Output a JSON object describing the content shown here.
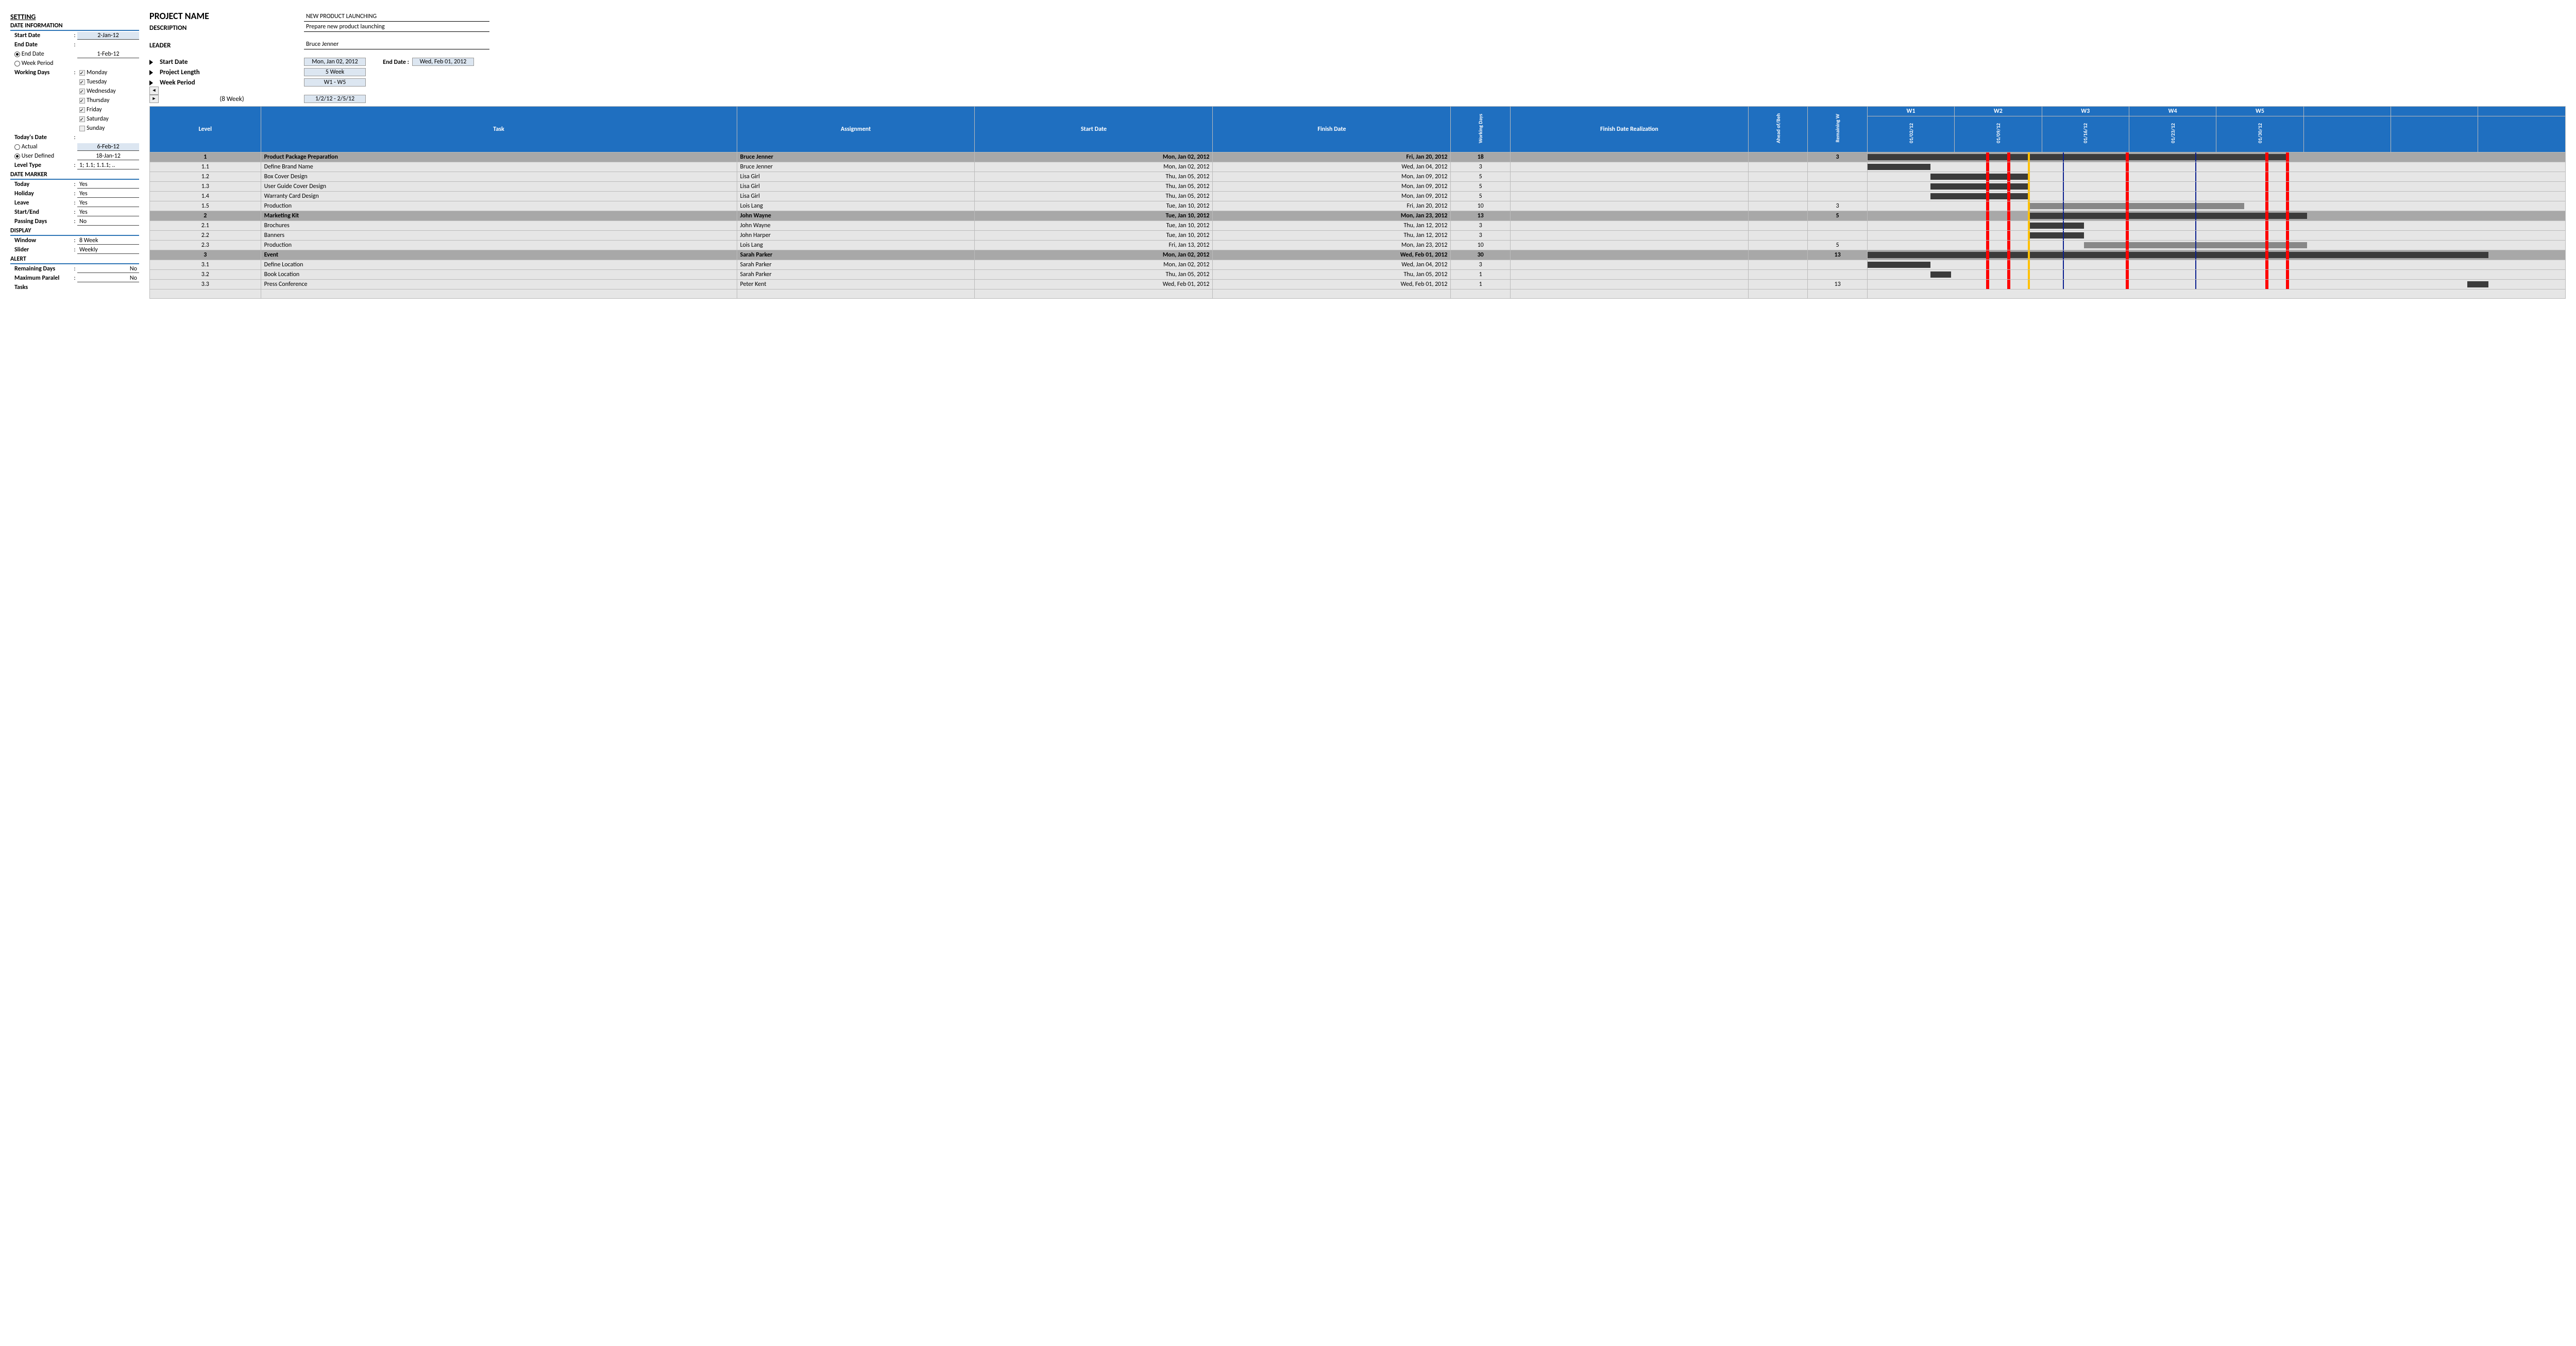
{
  "settings": {
    "title": "SETTING",
    "dateInfo": {
      "header": "DATE INFORMATION",
      "startDateLabel": "Start Date",
      "startDate": "2-Jan-12",
      "endDateLabel": "End Date",
      "endDateRadioLabel": "End Date",
      "endDate": "1-Feb-12",
      "weekPeriodRadioLabel": "Week Period",
      "workingDaysLabel": "Working Days",
      "days": [
        "Monday",
        "Tuesday",
        "Wednesday",
        "Thursday",
        "Friday",
        "Saturday",
        "Sunday"
      ]
    },
    "today": {
      "label": "Today's Date",
      "actualLabel": "Actual",
      "actualDate": "6-Feb-12",
      "userDefLabel": "User Defined",
      "userDefDate": "18-Jan-12",
      "levelTypeLabel": "Level Type",
      "levelType": "1; 1.1; 1.1.1; .."
    },
    "marker": {
      "header": "DATE MARKER",
      "items": [
        {
          "label": "Today",
          "value": "Yes"
        },
        {
          "label": "Holiday",
          "value": "Yes"
        },
        {
          "label": "Leave",
          "value": "Yes"
        },
        {
          "label": "Start/End",
          "value": "Yes"
        },
        {
          "label": "Passing Days",
          "value": "No"
        }
      ]
    },
    "display": {
      "header": "DISPLAY",
      "windowLabel": "Window",
      "window": "8 Week",
      "sliderLabel": "Slider",
      "slider": "Weekly"
    },
    "alert": {
      "header": "ALERT",
      "remLabel": "Remaining Days",
      "rem": "No",
      "maxLabel": "Maximum Paralel",
      "max": "No",
      "tasksLabel": "Tasks"
    }
  },
  "project": {
    "nameLabel": "PROJECT NAME",
    "name": "NEW PRODUCT LAUNCHING",
    "descLabel": "DESCRIPTION",
    "desc": "Prepare new product launching",
    "leaderLabel": "LEADER",
    "leader": "Bruce Jenner",
    "startDateLabel": "Start Date",
    "startDate": "Mon, Jan 02, 2012",
    "endDateLabel": "End Date :",
    "endDate": "Wed, Feb 01, 2012",
    "lengthLabel": "Project Length",
    "length": "5 Week",
    "weekPeriodLabel": "Week Period",
    "weekPeriod": "W1 - W5",
    "windowNote": "(8 Week)",
    "windowRange": "1/2/12 - 2/5/12"
  },
  "grid": {
    "headers": {
      "level": "Level",
      "task": "Task",
      "assignment": "Assignment",
      "start": "Start Date",
      "finish": "Finish Date",
      "wd": "Working Days",
      "fr": "Finish Date Realization",
      "ab": "Ahead of/Beh",
      "rw": "Remaining W"
    },
    "weeks": [
      "W1",
      "W2",
      "W3",
      "W4",
      "W5",
      "",
      "",
      ""
    ],
    "weekDates": [
      "01/02/12",
      "01/09/12",
      "01/16/12",
      "01/23/12",
      "01/30/12",
      "",
      "",
      ""
    ],
    "rows": [
      {
        "sum": true,
        "level": "1",
        "task": "Product Package Preparation",
        "asg": "Bruce Jenner",
        "sd": "Mon, Jan 02, 2012",
        "fd": "Fri, Jan 20, 2012",
        "wd": "18",
        "rw": "3",
        "barStart": 0,
        "barEnd": 60,
        "lt": false
      },
      {
        "sum": false,
        "level": "1.1",
        "task": "Define Brand Name",
        "asg": "Bruce Jenner",
        "sd": "Mon, Jan 02, 2012",
        "fd": "Wed, Jan 04, 2012",
        "wd": "3",
        "rw": "",
        "barStart": 0,
        "barEnd": 9,
        "lt": false
      },
      {
        "sum": false,
        "level": "1.2",
        "task": "Box Cover Design",
        "asg": "Lisa Girl",
        "sd": "Thu, Jan 05, 2012",
        "fd": "Mon, Jan 09, 2012",
        "wd": "5",
        "rw": "",
        "barStart": 9,
        "barEnd": 23,
        "lt": false
      },
      {
        "sum": false,
        "level": "1.3",
        "task": "User Guide Cover Design",
        "asg": "Lisa Girl",
        "sd": "Thu, Jan 05, 2012",
        "fd": "Mon, Jan 09, 2012",
        "wd": "5",
        "rw": "",
        "barStart": 9,
        "barEnd": 23,
        "lt": false
      },
      {
        "sum": false,
        "level": "1.4",
        "task": "Warranty Card Design",
        "asg": "Lisa Girl",
        "sd": "Thu, Jan 05, 2012",
        "fd": "Mon, Jan 09, 2012",
        "wd": "5",
        "rw": "",
        "barStart": 9,
        "barEnd": 23,
        "lt": false
      },
      {
        "sum": false,
        "level": "1.5",
        "task": "Production",
        "asg": "Lois Lang",
        "sd": "Tue, Jan 10, 2012",
        "fd": "Fri, Jan 20, 2012",
        "wd": "10",
        "rw": "3",
        "barStart": 23,
        "barEnd": 54,
        "lt": true
      },
      {
        "sum": true,
        "level": "2",
        "task": "Marketing Kit",
        "asg": "John Wayne",
        "sd": "Tue, Jan 10, 2012",
        "fd": "Mon, Jan 23, 2012",
        "wd": "13",
        "rw": "5",
        "barStart": 23,
        "barEnd": 63,
        "lt": false
      },
      {
        "sum": false,
        "level": "2.1",
        "task": "Brochures",
        "asg": "John Wayne",
        "sd": "Tue, Jan 10, 2012",
        "fd": "Thu, Jan 12, 2012",
        "wd": "3",
        "rw": "",
        "barStart": 23,
        "barEnd": 31,
        "lt": false
      },
      {
        "sum": false,
        "level": "2.2",
        "task": "Banners",
        "asg": "John Harper",
        "sd": "Tue, Jan 10, 2012",
        "fd": "Thu, Jan 12, 2012",
        "wd": "3",
        "rw": "",
        "barStart": 23,
        "barEnd": 31,
        "lt": false
      },
      {
        "sum": false,
        "level": "2.3",
        "task": "Production",
        "asg": "Lois Lang",
        "sd": "Fri, Jan 13, 2012",
        "fd": "Mon, Jan 23, 2012",
        "wd": "10",
        "rw": "5",
        "barStart": 31,
        "barEnd": 63,
        "lt": true
      },
      {
        "sum": true,
        "level": "3",
        "task": "Event",
        "asg": "Sarah Parker",
        "sd": "Mon, Jan 02, 2012",
        "fd": "Wed, Feb 01, 2012",
        "wd": "30",
        "rw": "13",
        "barStart": 0,
        "barEnd": 89,
        "lt": false
      },
      {
        "sum": false,
        "level": "3.1",
        "task": "Define Location",
        "asg": "Sarah Parker",
        "sd": "Mon, Jan 02, 2012",
        "fd": "Wed, Jan 04, 2012",
        "wd": "3",
        "rw": "",
        "barStart": 0,
        "barEnd": 9,
        "lt": false
      },
      {
        "sum": false,
        "level": "3.2",
        "task": "Book Location",
        "asg": "Sarah Parker",
        "sd": "Thu, Jan 05, 2012",
        "fd": "Thu, Jan 05, 2012",
        "wd": "1",
        "rw": "",
        "barStart": 9,
        "barEnd": 12,
        "lt": false
      },
      {
        "sum": false,
        "level": "3.3",
        "task": "Press Conference",
        "asg": "Peter Kent",
        "sd": "Wed, Feb 01, 2012",
        "fd": "Wed, Feb 01, 2012",
        "wd": "1",
        "rw": "13",
        "barStart": 86,
        "barEnd": 89,
        "lt": false
      }
    ],
    "markers": {
      "red": [
        17,
        20,
        37,
        57,
        60
      ],
      "yellow": [
        23
      ],
      "blue": [
        28,
        47
      ]
    }
  }
}
